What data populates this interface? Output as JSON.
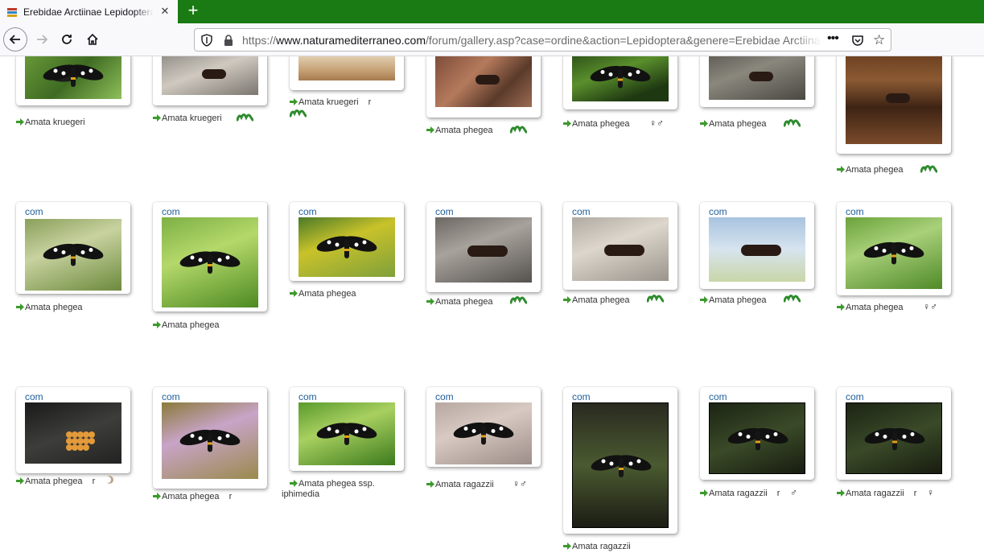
{
  "browser": {
    "tab_title": "Erebidae Arctiinae Lepidoptera",
    "url_domain": "www.naturamediterraneo.com",
    "url_scheme": "https://",
    "url_path": "/forum/gallery.asp?case=ordine&action=Lepidoptera&genere=Erebidae Arctiinae",
    "new_tab_symbol": "+",
    "close_symbol": "✕",
    "more_symbol": "•••"
  },
  "gallery": {
    "com_label": "com",
    "row1": [
      {
        "caption": "Amata kruegeri",
        "extra": "",
        "symbol": "",
        "caterpillar": false
      },
      {
        "caption": "Amata kruegeri",
        "extra": "",
        "symbol": "",
        "caterpillar": true
      },
      {
        "caption": "Amata kruegeri",
        "extra": "r",
        "symbol": "",
        "caterpillar": true
      },
      {
        "caption": "Amata phegea",
        "extra": "",
        "symbol": "",
        "caterpillar": true
      },
      {
        "caption": "Amata phegea",
        "extra": "",
        "symbol": "♀♂",
        "caterpillar": false
      },
      {
        "caption": "Amata phegea",
        "extra": "",
        "symbol": "",
        "caterpillar": true
      },
      {
        "caption": "Amata phegea",
        "extra": "",
        "symbol": "",
        "caterpillar": true
      }
    ],
    "row2": [
      {
        "caption": "Amata phegea",
        "extra": "",
        "symbol": "",
        "caterpillar": false
      },
      {
        "caption": "Amata phegea",
        "extra": "",
        "symbol": "",
        "caterpillar": false
      },
      {
        "caption": "Amata phegea",
        "extra": "",
        "symbol": "",
        "caterpillar": false
      },
      {
        "caption": "Amata phegea",
        "extra": "",
        "symbol": "",
        "caterpillar": true
      },
      {
        "caption": "Amata phegea",
        "extra": "",
        "symbol": "",
        "caterpillar": true
      },
      {
        "caption": "Amata phegea",
        "extra": "",
        "symbol": "",
        "caterpillar": true
      },
      {
        "caption": "Amata phegea",
        "extra": "",
        "symbol": "♀♂",
        "caterpillar": false
      }
    ],
    "row3": [
      {
        "caption": "Amata phegea",
        "extra": "r",
        "symbol": "",
        "egg": true
      },
      {
        "caption": "Amata phegea",
        "extra": "r",
        "symbol": ""
      },
      {
        "caption": "Amata phegea ssp.",
        "caption2": "iphimedia",
        "extra": "",
        "symbol": ""
      },
      {
        "caption": "Amata ragazzii",
        "extra": "",
        "symbol": "♀♂"
      },
      {
        "caption": "Amata ragazzii",
        "extra": "",
        "symbol": ""
      },
      {
        "caption": "Amata ragazzii",
        "extra": "r",
        "symbol": "♂"
      },
      {
        "caption": "Amata ragazzii",
        "extra": "r",
        "symbol": "♀"
      }
    ]
  }
}
